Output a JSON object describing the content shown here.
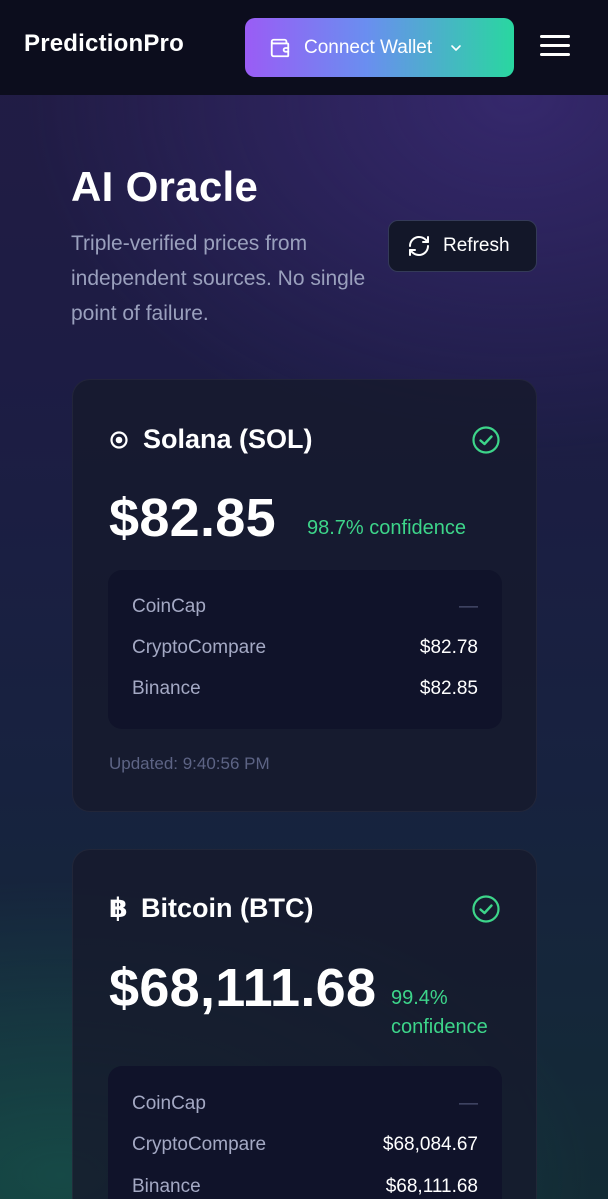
{
  "header": {
    "brand": "PredictionPro",
    "wallet_label": "Connect Wallet"
  },
  "intro": {
    "title": "AI Oracle",
    "subtitle": "Triple-verified prices from independent sources. No single point of failure.",
    "refresh_label": "Refresh"
  },
  "cards": [
    {
      "name": "Solana (SOL)",
      "price": "$82.85",
      "confidence": "98.7% confidence",
      "sources": [
        {
          "name": "CoinCap",
          "value": "—"
        },
        {
          "name": "CryptoCompare",
          "value": "$82.78"
        },
        {
          "name": "Binance",
          "value": "$82.85"
        }
      ],
      "updated": "Updated: 9:40:56 PM",
      "status_color": "#3dd58a"
    },
    {
      "name": "Bitcoin (BTC)",
      "price": "$68,111.68",
      "confidence_line1": "99.4%",
      "confidence_line2": "confidence",
      "sources": [
        {
          "name": "CoinCap",
          "value": "—"
        },
        {
          "name": "CryptoCompare",
          "value": "$68,084.67"
        },
        {
          "name": "Binance",
          "value": "$68,111.68"
        }
      ],
      "status_color": "#3dd58a"
    }
  ],
  "colors": {
    "accent_green": "#3dd58a",
    "wallet_gradient_start": "#9a5cf5",
    "wallet_gradient_end": "#29d7a0"
  }
}
